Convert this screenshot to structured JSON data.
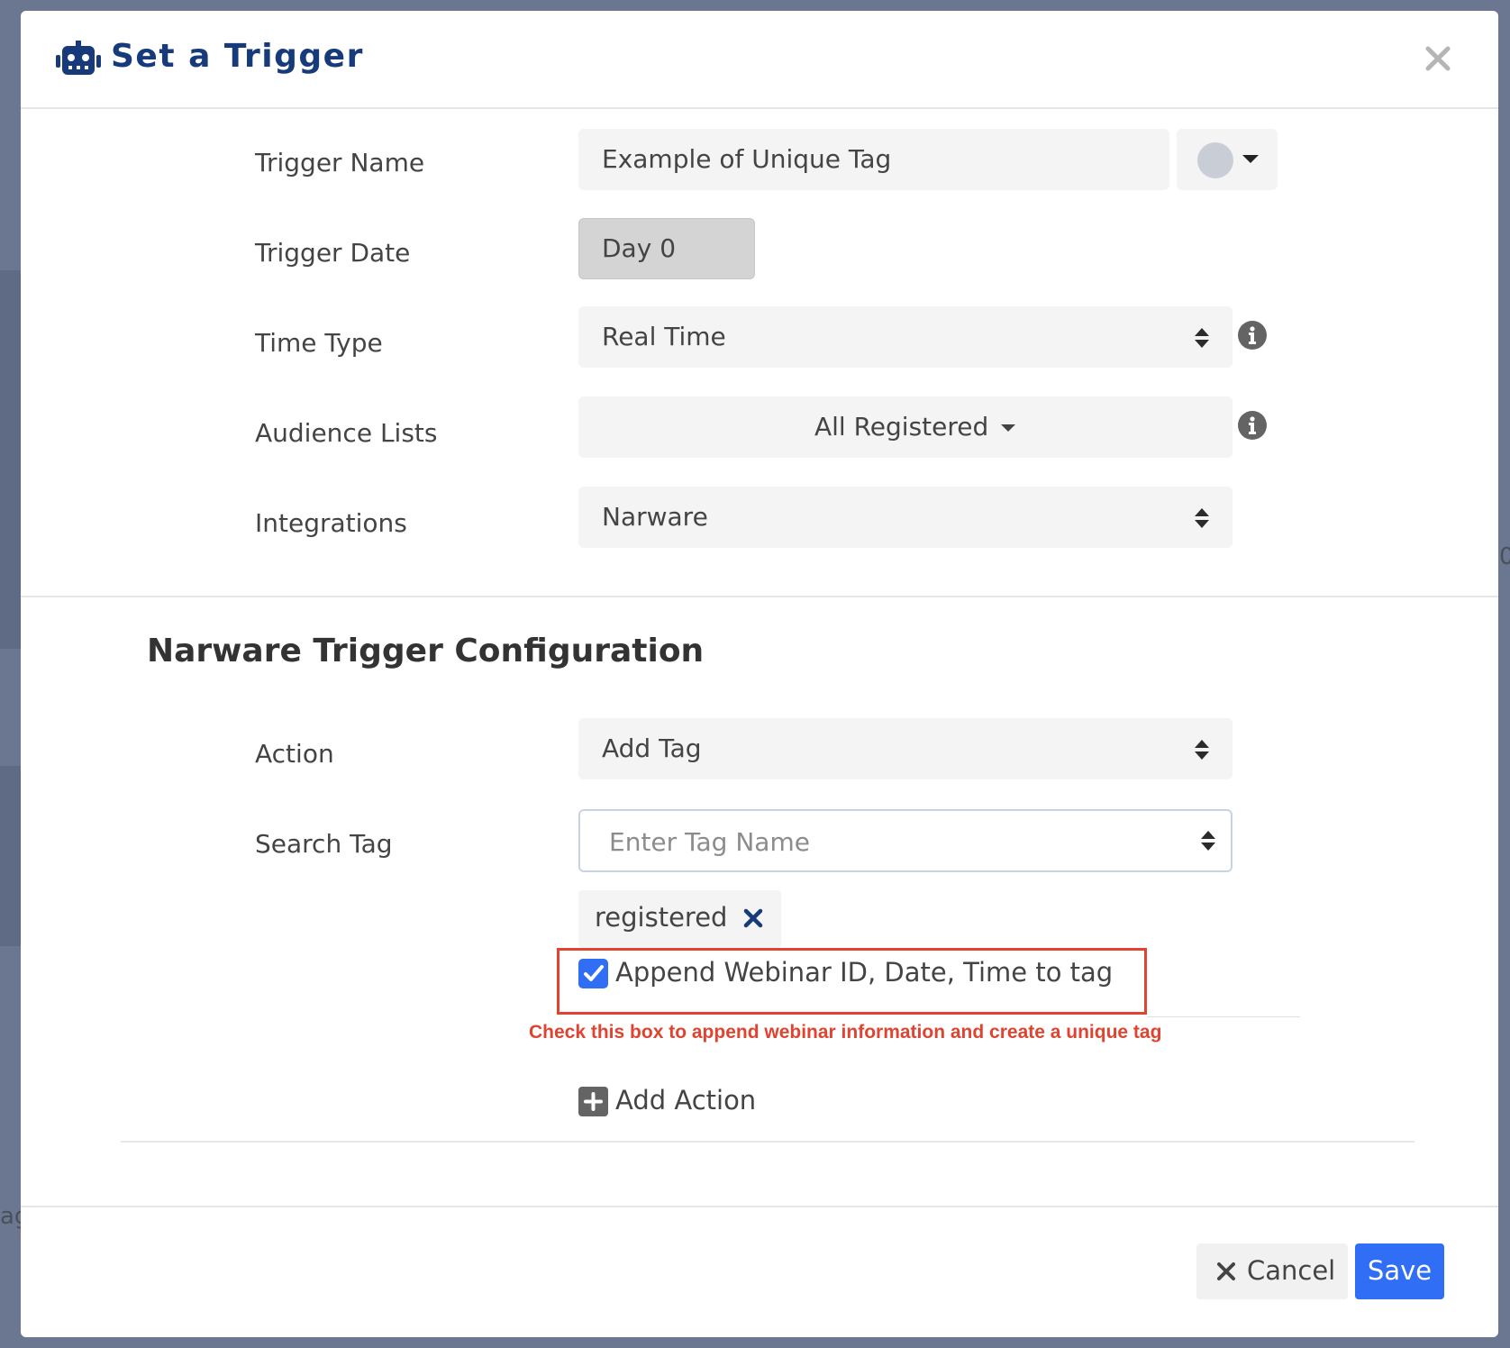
{
  "modal": {
    "title": "Set a Trigger",
    "icon": "robot-icon",
    "close_icon": "close-icon"
  },
  "form": {
    "trigger_name": {
      "label": "Trigger Name",
      "value": "Example of Unique Tag",
      "color_dot": "#c9ced6"
    },
    "trigger_date": {
      "label": "Trigger Date",
      "value": "Day 0"
    },
    "time_type": {
      "label": "Time Type",
      "value": "Real Time"
    },
    "audience_lists": {
      "label": "Audience Lists",
      "value": "All Registered"
    },
    "integrations": {
      "label": "Integrations",
      "value": "Narware"
    }
  },
  "config": {
    "title": "Narware Trigger Configuration",
    "action": {
      "label": "Action",
      "value": "Add Tag"
    },
    "search_tag": {
      "label": "Search Tag",
      "placeholder": "Enter Tag Name",
      "value": ""
    },
    "tags": [
      "registered"
    ],
    "append_checkbox": {
      "label": "Append Webinar ID, Date, Time to tag",
      "checked": true
    },
    "annotation": "Check this box to append webinar information and create a unique tag",
    "add_action_label": "Add Action"
  },
  "footer": {
    "cancel_label": "Cancel",
    "save_label": "Save"
  },
  "colors": {
    "title_navy": "#173a7a",
    "primary_blue": "#2f6ef5",
    "annotation_red": "#e0432f",
    "overlay": "#6b7790"
  },
  "background": {
    "edge_text_bottom": "ag",
    "edge_text_right": "0"
  }
}
